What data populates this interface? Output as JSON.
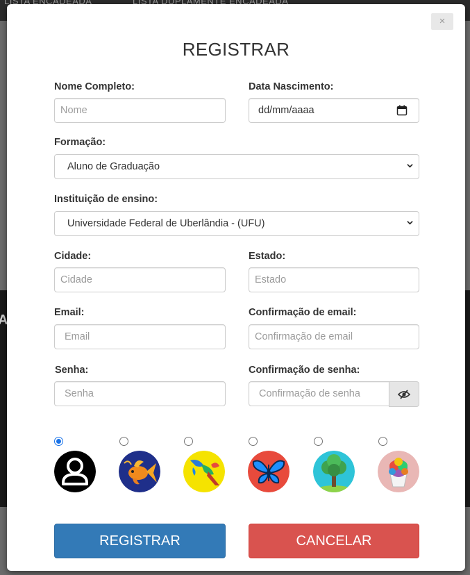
{
  "background": {
    "nav_items": [
      "LISTA ENCADEADA",
      "LISTA DUPLAMENTE ENCADEADA"
    ],
    "side_letter": "A"
  },
  "modal": {
    "close_label": "×",
    "title": "REGISTRAR",
    "fields": {
      "nome": {
        "label": "Nome Completo:",
        "placeholder": "Nome"
      },
      "nascimento": {
        "label": "Data Nascimento:",
        "value": "dd/mm/aaaa"
      },
      "formacao": {
        "label": "Formação:",
        "selected": "Aluno de Graduação"
      },
      "instituicao": {
        "label": "Instituição de ensino:",
        "selected": "Universidade Federal de Uberlândia - (UFU)"
      },
      "cidade": {
        "label": "Cidade:",
        "placeholder": "Cidade"
      },
      "estado": {
        "label": "Estado:",
        "placeholder": "Estado"
      },
      "email": {
        "label": "Email:",
        "placeholder": "Email"
      },
      "email_confirm": {
        "label": "Confirmação de email:",
        "placeholder": "Confirmação de email"
      },
      "senha": {
        "label": "Senha:",
        "placeholder": "Senha"
      },
      "senha_confirm": {
        "label": "Confirmação de senha:",
        "placeholder": "Confirmação de senha"
      }
    },
    "avatars": [
      {
        "name": "person-icon",
        "selected": true,
        "bg": "#000000"
      },
      {
        "name": "goldfish-icon",
        "selected": false,
        "bg": "#1f2f8a"
      },
      {
        "name": "parrot-icon",
        "selected": false,
        "bg": "#f5e300"
      },
      {
        "name": "butterfly-icon",
        "selected": false,
        "bg": "#e84a3c"
      },
      {
        "name": "tree-icon",
        "selected": false,
        "bg": "#2ec4d8"
      },
      {
        "name": "cupcake-icon",
        "selected": false,
        "bg": "#e9b7b5"
      }
    ],
    "buttons": {
      "register": "REGISTRAR",
      "cancel": "CANCELAR"
    },
    "colors": {
      "primary": "#337ab7",
      "danger": "#d9534f",
      "radio_checked": "#1a73e8"
    }
  }
}
